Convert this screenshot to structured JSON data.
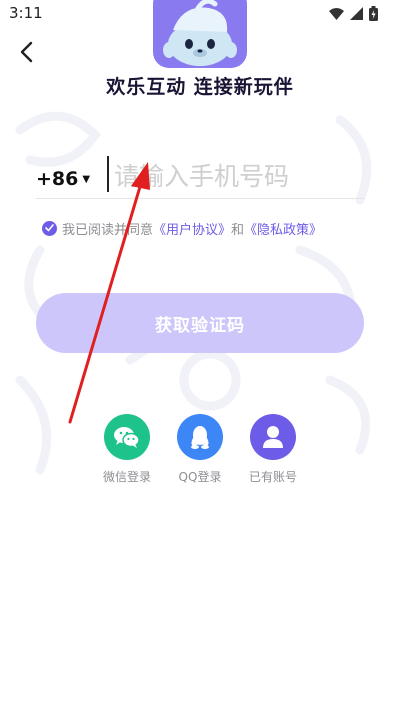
{
  "status_bar": {
    "time": "3:11"
  },
  "header": {
    "tagline": "欢乐互动 连接新玩伴"
  },
  "phone": {
    "country_code": "+86",
    "placeholder": "请输入手机号码",
    "value": ""
  },
  "agreement": {
    "prefix": "我已阅读并同意",
    "user_agreement": "《用户协议》",
    "and": "和",
    "privacy_policy": "《隐私政策》",
    "checked": true
  },
  "get_code_button": {
    "label": "获取验证码"
  },
  "social_login": [
    {
      "label": "微信登录",
      "icon": "wechat-icon",
      "color": "#1ec28b"
    },
    {
      "label": "QQ登录",
      "icon": "qq-icon",
      "color": "#3d86f5"
    },
    {
      "label": "已有账号",
      "icon": "user-icon",
      "color": "#6c5ce7"
    }
  ],
  "colors": {
    "accent": "#6c5ce7",
    "button_disabled": "#ccc6fb",
    "annotation_arrow": "#e02020"
  }
}
